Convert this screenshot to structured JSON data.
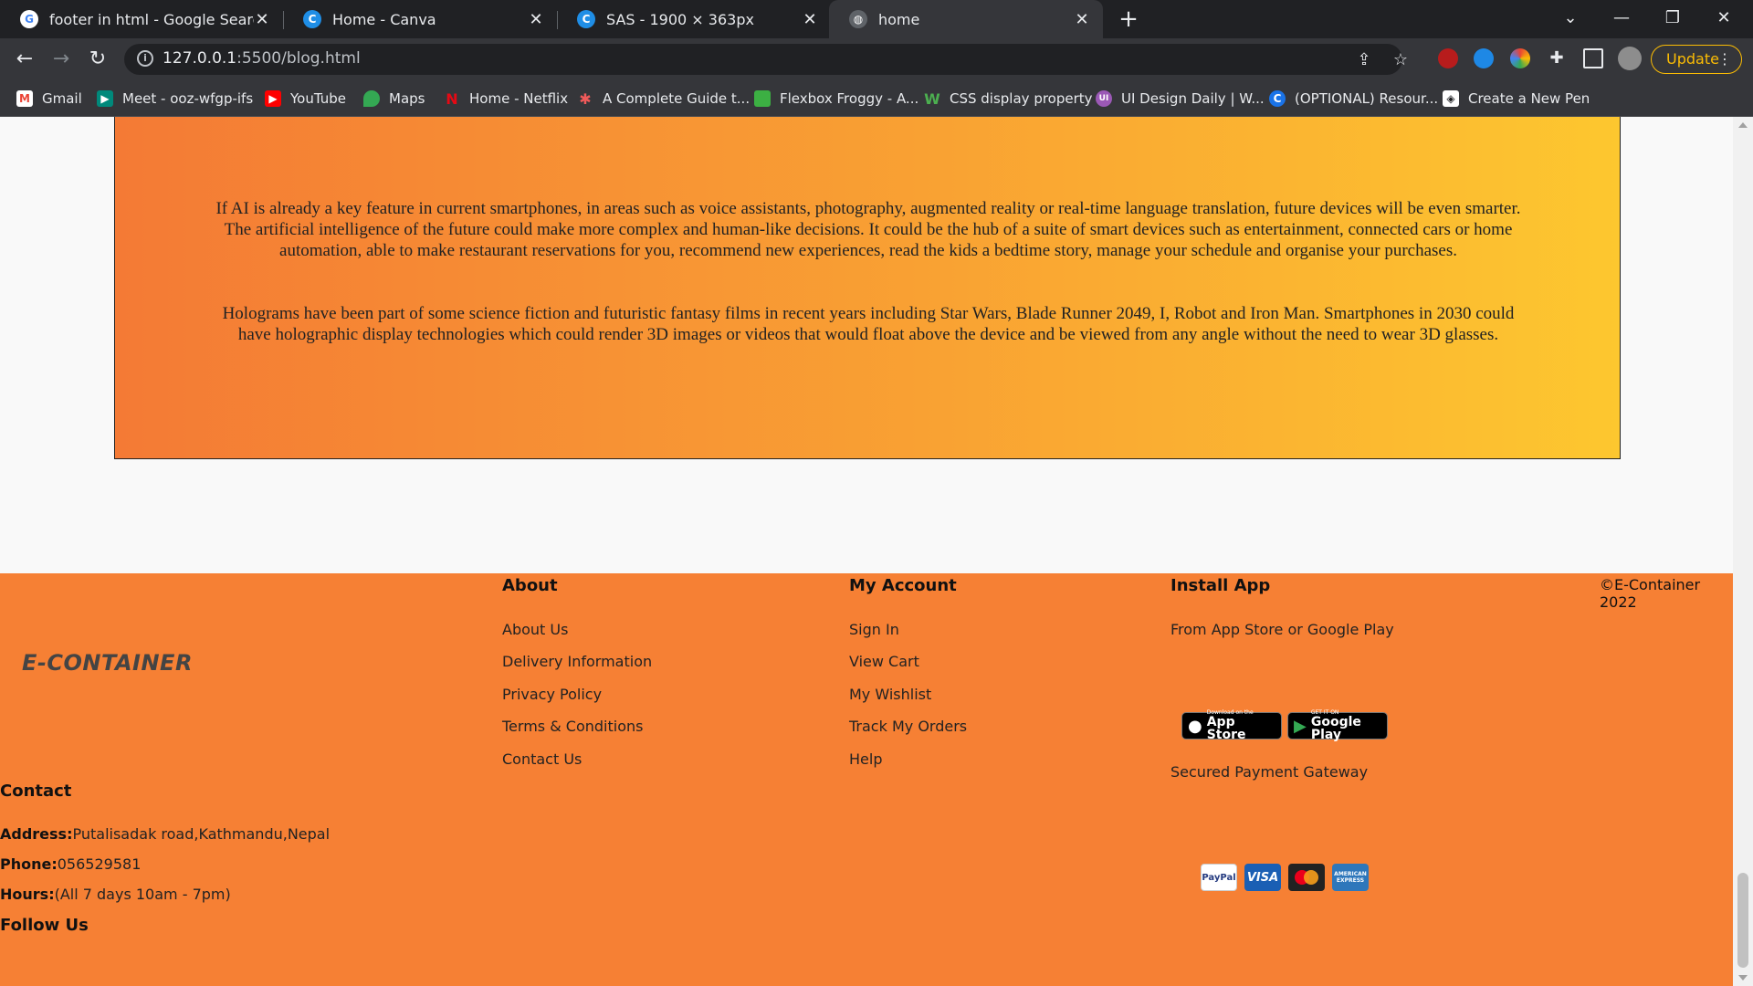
{
  "browser": {
    "tabs": [
      {
        "title": "footer in html - Google Search",
        "favicon": "google-icon"
      },
      {
        "title": "Home - Canva",
        "favicon": "canva-icon"
      },
      {
        "title": "SAS - 1900 × 363px",
        "favicon": "canva-icon"
      },
      {
        "title": "home",
        "favicon": "globe-icon"
      }
    ],
    "address": {
      "host": "127.0.0.1",
      "path": ":5500/blog.html"
    },
    "update_label": "Update",
    "bookmarks": [
      {
        "label": "Gmail",
        "icon": "gmail-icon",
        "color": "#ea4335"
      },
      {
        "label": "Meet - ooz-wfgp-ifs",
        "icon": "meet-icon",
        "color": "#00897b"
      },
      {
        "label": "YouTube",
        "icon": "youtube-icon",
        "color": "#ff0000"
      },
      {
        "label": "Maps",
        "icon": "maps-icon",
        "color": "#34a853"
      },
      {
        "label": "Home - Netflix",
        "icon": "netflix-icon",
        "color": "#e50914"
      },
      {
        "label": "A Complete Guide t...",
        "icon": "css-tricks-icon",
        "color": "#f05a5a"
      },
      {
        "label": "Flexbox Froggy - A...",
        "icon": "frog-icon",
        "color": "#3cb043"
      },
      {
        "label": "CSS display property",
        "icon": "w3-icon",
        "color": "#4caf50"
      },
      {
        "label": "UI Design Daily | W...",
        "icon": "ui-icon",
        "color": "#9b59b6"
      },
      {
        "label": "(OPTIONAL) Resour...",
        "icon": "c-icon",
        "color": "#1a73e8"
      },
      {
        "label": "Create a New Pen",
        "icon": "codepen-icon",
        "color": "#202124"
      }
    ]
  },
  "blog": {
    "para1": "If AI is already a key feature in current smartphones, in areas such as voice assistants, photography, augmented reality or real-time language translation, future devices will be even smarter. The artificial intelligence of the future could make more complex and human-like decisions. It could be the hub of a suite of smart devices such as entertainment, connected cars or home automation, able to make restaurant reservations for you, recommend new experiences, read the kids a bedtime story, manage your schedule and organise your purchases.",
    "para2": "Holograms have been part of some science fiction and futuristic fantasy films in recent years including Star Wars, Blade Runner 2049, I, Robot and Iron Man. Smartphones in 2030 could have holographic display technologies which could render 3D images or videos that would float above the device and be viewed from any angle without the need to wear 3D glasses."
  },
  "footer": {
    "brand": "E-CONTAINER",
    "contact": {
      "heading": "Contact",
      "address_label": "Address:",
      "address": "Putalisadak road,Kathmandu,Nepal",
      "phone_label": "Phone:",
      "phone": "056529581",
      "hours_label": "Hours:",
      "hours": "(All 7 days 10am - 7pm)",
      "follow": "Follow Us"
    },
    "about": {
      "heading": "About",
      "links": [
        "About Us",
        "Delivery Information",
        "Privacy Policy",
        "Terms & Conditions",
        "Contact Us"
      ]
    },
    "account": {
      "heading": "My Account",
      "links": [
        "Sign In",
        "View Cart",
        "My Wishlist",
        "Track My Orders",
        "Help"
      ]
    },
    "install": {
      "heading": "Install App",
      "subtitle": "From App Store or Google Play",
      "app_store_small": "Download on the",
      "app_store": "App Store",
      "google_play_small": "GET IT ON",
      "google_play": "Google Play",
      "secured": "Secured Payment Gateway",
      "payments": [
        {
          "label": "PayPal",
          "color": "#253b80"
        },
        {
          "label": "VISA",
          "color": "#1a5fb4"
        },
        {
          "label": "",
          "color": "#222222"
        },
        {
          "label": "AMERICAN EXPRESS",
          "color": "#2e77bb"
        }
      ]
    },
    "copyright": "©E-Container 2022"
  }
}
